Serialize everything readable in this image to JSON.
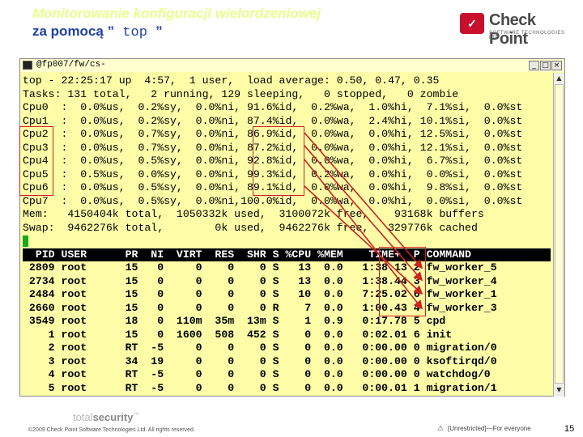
{
  "slide": {
    "title_line1": "Monitorowanie konfiguracji wielordzeniowej",
    "title_line2_prefix": "za pomocą ”",
    "title_command": " top ",
    "title_line2_suffix": "”",
    "page_number": "15",
    "copyright": "©2009 Check Point Software Technologies Ltd. All rights reserved.",
    "classification": "[Unrestricted]—For everyone",
    "footer_brand_prefix": "total",
    "footer_brand_suffix": "security",
    "footer_brand_tm": "™"
  },
  "logo": {
    "name": "Check Point",
    "subtitle": "SOFTWARE TECHNOLOGIES LTD.",
    "icon": "check-point-logo-icon"
  },
  "window": {
    "title": "@fp007/fw/cs-",
    "minimize_label": "_",
    "maximize_label": "□",
    "close_label": "×",
    "scroll_up": "▲",
    "scroll_down": "▼"
  },
  "terminal": {
    "summary_lines": [
      "top - 22:25:17 up  4:57,  1 user,  load average: 0.50, 0.47, 0.35",
      "Tasks: 131 total,   2 running, 129 sleeping,   0 stopped,   0 zombie",
      "Cpu0  :  0.0%us,  0.2%sy,  0.0%ni, 91.6%id,  0.2%wa,  1.0%hi,  7.1%si,  0.0%st",
      "Cpu1  :  0.0%us,  0.2%sy,  0.0%ni, 87.4%id,  0.0%wa,  2.4%hi, 10.1%si,  0.0%st",
      "Cpu2  :  0.0%us,  0.7%sy,  0.0%ni, 86.9%id,  0.0%wa,  0.0%hi, 12.5%si,  0.0%st",
      "Cpu3  :  0.0%us,  0.7%sy,  0.0%ni, 87.2%id,  0.0%wa,  0.0%hi, 12.1%si,  0.0%st",
      "Cpu4  :  0.0%us,  0.5%sy,  0.0%ni, 92.8%id,  0.0%wa,  0.0%hi,  6.7%si,  0.0%st",
      "Cpu5  :  0.5%us,  0.0%sy,  0.0%ni, 99.3%id,  0.2%wa,  0.0%hi,  0.0%si,  0.0%st",
      "Cpu6  :  0.0%us,  0.5%sy,  0.0%ni, 89.1%id,  0.0%wa,  0.0%hi,  9.8%si,  0.0%st",
      "Cpu7  :  0.0%us,  0.5%sy,  0.0%ni,100.0%id,  0.0%wa,  0.0%hi,  0.0%si,  0.0%st",
      "Mem:   4150404k total,  1050332k used,  3100072k free,    93168k buffers",
      "Swap:  9462276k total,        0k used,  9462276k free,   329776k cached"
    ],
    "process_header": "  PID USER      PR  NI  VIRT  RES  SHR S %CPU %MEM    TIME+  P COMMAND",
    "process_lines": [
      " 2809 root      15   0     0    0    0 S   13  0.0   1:38.13 2 fw_worker_5",
      " 2734 root      15   0     0    0    0 S   13  0.0   1:38.44 3 fw_worker_4",
      " 2484 root      15   0     0    0    0 S   10  0.0   7:25.02 6 fw_worker_1",
      " 2660 root      15   0     0    0    0 R    7  0.0   1:00.43 4 fw_worker_3",
      " 3549 root      18   0  110m  35m  13m S    1  0.9   0:17.78 5 cpd",
      "    1 root      15   0  1600  508  452 S    0  0.0   0:02.01 6 init",
      "    2 root      RT  -5     0    0    0 S    0  0.0   0:00.00 0 migration/0",
      "    3 root      34  19     0    0    0 S    0  0.0   0:00.00 0 ksoftirqd/0",
      "    4 root      RT  -5     0    0    0 S    0  0.0   0:00.00 0 watchdog/0",
      "    5 root      RT  -5     0    0    0 S    0  0.0   0:00.01 1 migration/1"
    ]
  },
  "colors": {
    "terminal_bg": "#fdfda8",
    "header_bg": "#000000",
    "highlight": "#d02020",
    "cursor": "#1aa81a"
  }
}
